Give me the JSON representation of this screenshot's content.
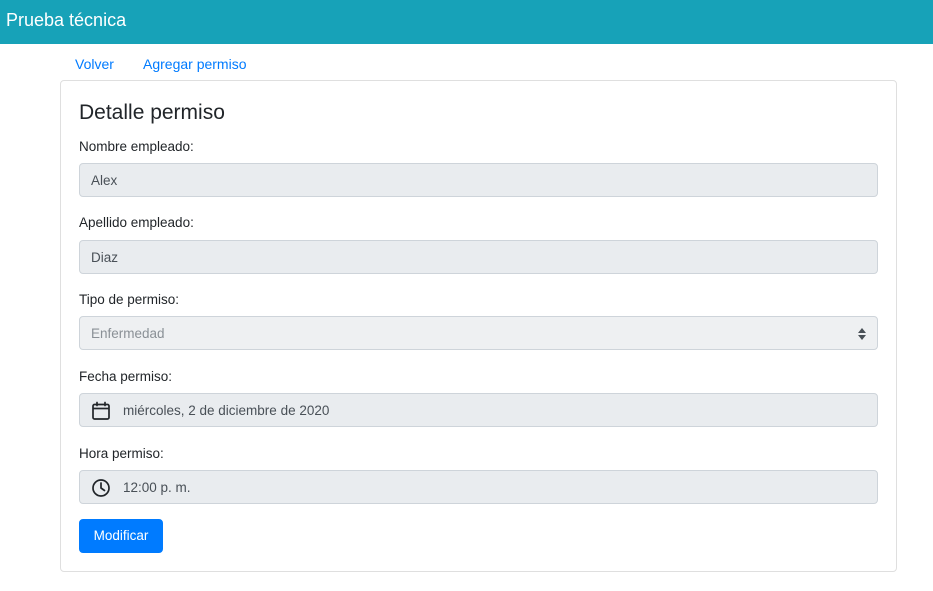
{
  "navbar": {
    "brand": "Prueba técnica",
    "color": "#17a2b8"
  },
  "subnav": {
    "back_label": "Volver",
    "add_label": "Agregar permiso",
    "link_color": "#007bff"
  },
  "form": {
    "title": "Detalle permiso",
    "fields": [
      {
        "label": "Nombre empleado:",
        "value": "Alex",
        "kind": "text"
      },
      {
        "label": "Apellido empleado:",
        "value": "Diaz",
        "kind": "text"
      },
      {
        "label": "Tipo de permiso:",
        "value": "Enfermedad",
        "kind": "select"
      },
      {
        "label": "Fecha permiso:",
        "value": "miércoles, 2 de diciembre de 2020",
        "kind": "date",
        "icon": "calendar-icon"
      },
      {
        "label": "Hora permiso:",
        "value": "12:00 p. m.",
        "kind": "time",
        "icon": "clock-icon"
      }
    ],
    "submit_label": "Modificar",
    "submit_color": "#007bff"
  }
}
